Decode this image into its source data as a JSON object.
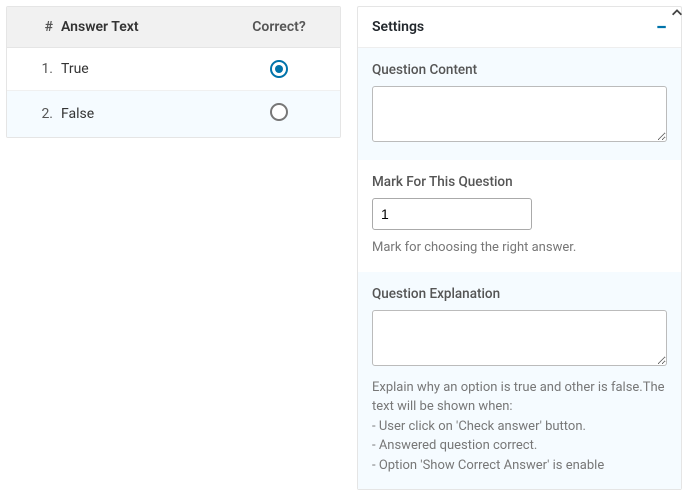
{
  "answers": {
    "header_num": "#",
    "header_text": "Answer Text",
    "header_correct": "Correct?",
    "rows": [
      {
        "num": "1.",
        "text": "True",
        "checked": true
      },
      {
        "num": "2.",
        "text": "False",
        "checked": false
      }
    ]
  },
  "settings": {
    "title": "Settings",
    "content": {
      "label": "Question Content",
      "value": ""
    },
    "mark": {
      "label": "Mark For This Question",
      "value": "1",
      "help": "Mark for choosing the right answer."
    },
    "explanation": {
      "label": "Question Explanation",
      "value": "",
      "help": "Explain why an option is true and other is false.The text will be shown when:",
      "help_lines": [
        "- User click on 'Check answer' button.",
        "- Answered question correct.",
        "- Option 'Show Correct Answer' is enable"
      ]
    }
  }
}
